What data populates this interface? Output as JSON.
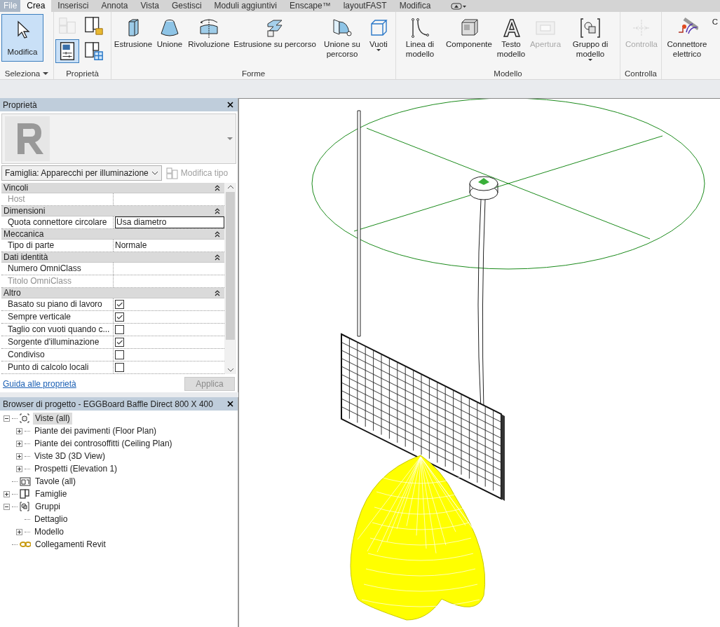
{
  "menu_tabs": [
    {
      "label": "File",
      "kind": "file",
      "selected": false
    },
    {
      "label": "Crea",
      "kind": "tab",
      "selected": true
    },
    {
      "label": "Inserisci",
      "kind": "tab",
      "selected": false
    },
    {
      "label": "Annota",
      "kind": "tab",
      "selected": false
    },
    {
      "label": "Vista",
      "kind": "tab",
      "selected": false
    },
    {
      "label": "Gestisci",
      "kind": "tab",
      "selected": false
    },
    {
      "label": "Moduli aggiuntivi",
      "kind": "tab",
      "selected": false
    },
    {
      "label": "Enscape™",
      "kind": "tab",
      "selected": false
    },
    {
      "label": "layoutFAST",
      "kind": "tab",
      "selected": false
    },
    {
      "label": "Modifica",
      "kind": "tab",
      "selected": false
    }
  ],
  "ribbon": {
    "panels": [
      {
        "title": "Seleziona",
        "dropdown": true,
        "tools": [
          {
            "label": "Modifica",
            "kind": "select",
            "selected": true,
            "disabled": false,
            "dropdown": false
          }
        ]
      },
      {
        "title": "Proprietà",
        "dropdown": false,
        "tools": [
          {
            "kind": "family-types",
            "selected": false,
            "disabled": true
          },
          {
            "kind": "family-category",
            "selected": false,
            "disabled": false
          },
          {
            "kind": "properties",
            "selected": true,
            "disabled": false
          },
          {
            "kind": "type-properties",
            "selected": false,
            "disabled": false
          }
        ]
      },
      {
        "title": "Forme",
        "dropdown": false,
        "tools": [
          {
            "label": "Estrusione",
            "kind": "extrusion",
            "selected": false,
            "disabled": false,
            "dropdown": false
          },
          {
            "label": "Unione",
            "kind": "blend",
            "selected": false,
            "disabled": false,
            "dropdown": false
          },
          {
            "label": "Rivoluzione",
            "kind": "revolve",
            "selected": false,
            "disabled": false,
            "dropdown": false
          },
          {
            "label": "Estrusione su percorso",
            "kind": "sweep",
            "selected": false,
            "disabled": false,
            "dropdown": false
          },
          {
            "label": "Unione su percorso",
            "kind": "swept-blend",
            "selected": false,
            "disabled": false,
            "dropdown": false
          },
          {
            "label": "Vuoti",
            "kind": "void",
            "selected": false,
            "disabled": false,
            "dropdown": true
          }
        ]
      },
      {
        "title": "Modello",
        "dropdown": false,
        "tools": [
          {
            "label": "Linea di modello",
            "kind": "line",
            "selected": false,
            "disabled": false,
            "dropdown": false
          },
          {
            "label": "Componente",
            "kind": "component",
            "selected": false,
            "disabled": false,
            "dropdown": false
          },
          {
            "label": "Testo modello",
            "kind": "text",
            "selected": false,
            "disabled": false,
            "dropdown": false
          },
          {
            "label": "Apertura",
            "kind": "opening",
            "selected": false,
            "disabled": true,
            "dropdown": false
          },
          {
            "label": "Gruppo di modello",
            "kind": "group",
            "selected": false,
            "disabled": false,
            "dropdown": true
          }
        ]
      },
      {
        "title": "Controlla",
        "dropdown": false,
        "tools": [
          {
            "label": "Controlla",
            "kind": "control",
            "selected": false,
            "disabled": true,
            "dropdown": false
          }
        ]
      },
      {
        "tools": [
          {
            "label": "Connettore elettrico",
            "kind": "connector",
            "selected": false,
            "disabled": false,
            "dropdown": false
          },
          {
            "label": "C",
            "kind": "cut",
            "selected": false,
            "disabled": false,
            "dropdown": false
          }
        ]
      }
    ]
  },
  "properties": {
    "title": "Proprietà",
    "type_selector": "Famiglia: Apparecchi per illuminazione",
    "edit_type": {
      "label": "Modifica tipo",
      "disabled": true
    },
    "groups": [
      {
        "name": "Vincoli",
        "rows": [
          {
            "label": "Host",
            "kind": "text",
            "value": "",
            "disabled": true
          }
        ]
      },
      {
        "name": "Dimensioni",
        "rows": [
          {
            "label": "Quota connettore circolare",
            "kind": "text",
            "value": "Usa diametro",
            "disabled": false,
            "editing": true
          }
        ]
      },
      {
        "name": "Meccanica",
        "rows": [
          {
            "label": "Tipo di parte",
            "kind": "text",
            "value": "Normale",
            "disabled": false
          }
        ]
      },
      {
        "name": "Dati identità",
        "rows": [
          {
            "label": "Numero OmniClass",
            "kind": "text",
            "value": "",
            "disabled": false
          },
          {
            "label": "Titolo OmniClass",
            "kind": "text",
            "value": "",
            "disabled": true
          }
        ]
      },
      {
        "name": "Altro",
        "rows": [
          {
            "label": "Basato su piano di lavoro",
            "kind": "check",
            "checked": true
          },
          {
            "label": "Sempre verticale",
            "kind": "check",
            "checked": true
          },
          {
            "label": "Taglio con vuoti quando c...",
            "kind": "check",
            "checked": false
          },
          {
            "label": "Sorgente d'illuminazione",
            "kind": "check",
            "checked": true
          },
          {
            "label": "Condiviso",
            "kind": "check",
            "checked": false
          },
          {
            "label": "Punto di calcolo locali",
            "kind": "check",
            "checked": false
          }
        ]
      }
    ],
    "help_link": "Guida alle proprietà",
    "apply": {
      "label": "Applica",
      "disabled": true
    }
  },
  "project_browser": {
    "title": "Browser di progetto - EGGBoard Baffle Direct 800 X 400",
    "tree": [
      {
        "label": "Viste (all)",
        "kind": "node",
        "expanded": true,
        "selected": true,
        "children": [
          {
            "label": "Piante dei pavimenti (Floor Plan)",
            "kind": "node",
            "expanded": false,
            "selected": false
          },
          {
            "label": "Piante dei controsoffitti (Ceiling Plan)",
            "kind": "node",
            "expanded": false,
            "selected": false
          },
          {
            "label": "Viste 3D (3D View)",
            "kind": "node",
            "expanded": false,
            "selected": false
          },
          {
            "label": "Prospetti (Elevation 1)",
            "kind": "node",
            "expanded": false,
            "selected": false
          }
        ]
      },
      {
        "label": "Tavole (all)",
        "kind": "leaf",
        "selected": false
      },
      {
        "label": "Famiglie",
        "kind": "node",
        "expanded": false,
        "selected": false
      },
      {
        "label": "Gruppi",
        "kind": "node",
        "expanded": true,
        "selected": false,
        "children": [
          {
            "label": "Dettaglio",
            "kind": "leaf",
            "selected": false
          },
          {
            "label": "Modello",
            "kind": "node",
            "expanded": false,
            "selected": false
          }
        ]
      },
      {
        "label": "Collegamenti Revit",
        "kind": "leaf",
        "selected": false
      }
    ]
  }
}
